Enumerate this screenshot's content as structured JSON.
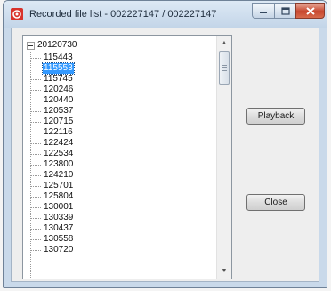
{
  "window": {
    "title": "Recorded file list - 002227147 / 002227147",
    "icons": {
      "app": "recorder-app-icon",
      "minimize": "minimize-icon",
      "maximize": "maximize-icon",
      "close": "close-x-icon"
    },
    "colors": {
      "frame": "#c9d9ea",
      "close_button": "#c7462e",
      "selection": "#3399ff"
    }
  },
  "tree": {
    "root_label": "20120730",
    "expander": "minus",
    "selected_index": 1,
    "items": [
      "115443",
      "115553",
      "115745",
      "120246",
      "120440",
      "120537",
      "120715",
      "122116",
      "122424",
      "122534",
      "123800",
      "124210",
      "125701",
      "125804",
      "130001",
      "130339",
      "130437",
      "130558",
      "130720"
    ]
  },
  "buttons": {
    "playback_label": "Playback",
    "close_label": "Close"
  }
}
